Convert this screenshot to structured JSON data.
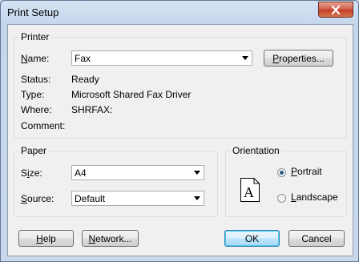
{
  "window": {
    "title": "Print Setup"
  },
  "printer": {
    "group_label": "Printer",
    "name_label": "Name:",
    "name_value": "Fax",
    "properties_label": "Properties...",
    "status_label": "Status:",
    "status_value": "Ready",
    "type_label": "Type:",
    "type_value": "Microsoft Shared Fax Driver",
    "where_label": "Where:",
    "where_value": "SHRFAX:",
    "comment_label": "Comment:",
    "comment_value": ""
  },
  "paper": {
    "group_label": "Paper",
    "size_label": "Size:",
    "size_value": "A4",
    "source_label": "Source:",
    "source_value": "Default"
  },
  "orientation": {
    "group_label": "Orientation",
    "icon_letter": "A",
    "portrait_label": "Portrait",
    "landscape_label": "Landscape",
    "selected": "Portrait"
  },
  "buttons": {
    "help": "Help",
    "network": "Network...",
    "ok": "OK",
    "cancel": "Cancel"
  },
  "colors": {
    "title_bar": "#c5d6ec",
    "close_button": "#c23c22",
    "dialog_bg": "#f0f0f0",
    "default_button_border": "#3c7fb1"
  }
}
